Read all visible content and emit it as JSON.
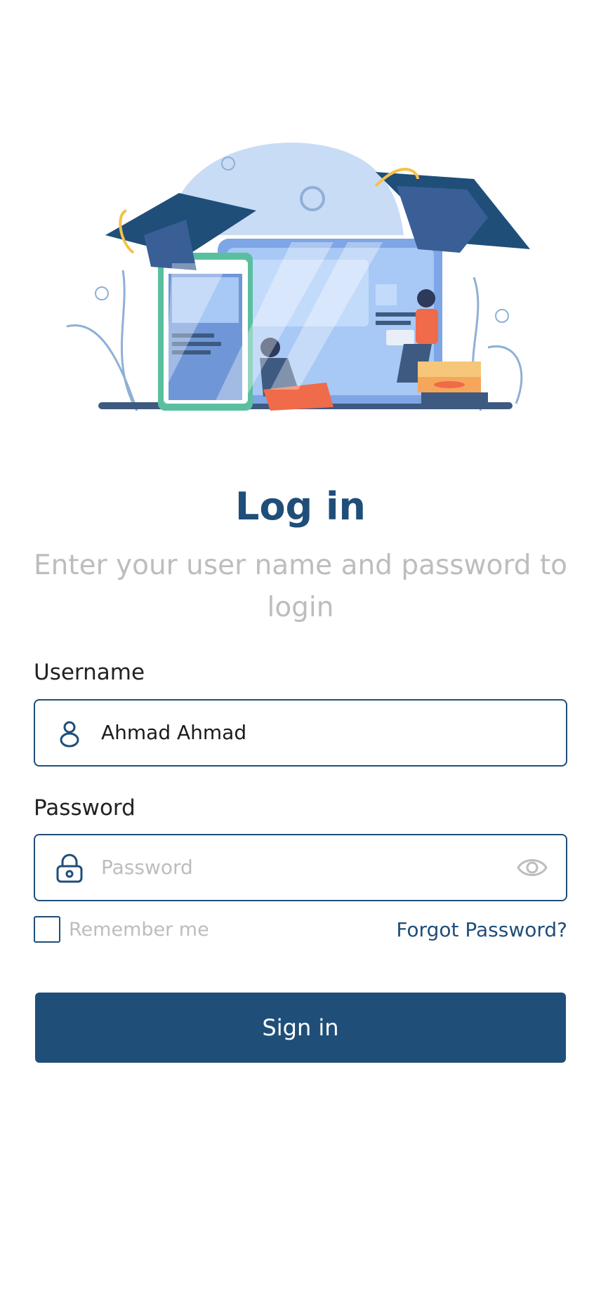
{
  "header": {
    "title": "Log in",
    "subtitle": "Enter your user name and password to login"
  },
  "form": {
    "username": {
      "label": "Username",
      "value": "Ahmad Ahmad",
      "icon": "user-icon"
    },
    "password": {
      "label": "Password",
      "placeholder": "Password",
      "icon": "lock-icon",
      "toggle_icon": "eye-icon"
    },
    "remember_label": "Remember me",
    "forgot_label": "Forgot Password?",
    "submit_label": "Sign in"
  },
  "colors": {
    "primary": "#1f4e79",
    "muted": "#bdbdbd",
    "text": "#222222"
  }
}
